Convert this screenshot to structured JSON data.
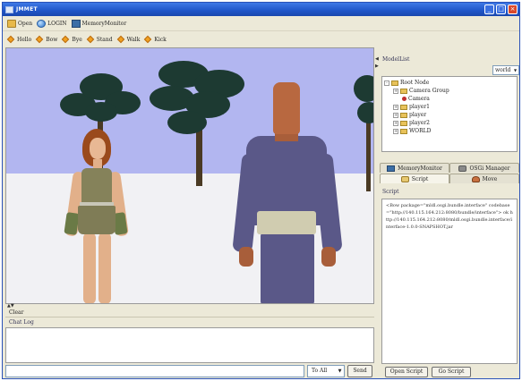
{
  "window": {
    "title": "JMMET",
    "controls": {
      "minimize": "_",
      "maximize": "□",
      "close": "×"
    }
  },
  "toolbar_main": {
    "items": [
      {
        "label": "Open",
        "icon": "folder-icon"
      },
      {
        "label": "LOGIN",
        "icon": "globe-icon"
      },
      {
        "label": "MemoryMonitor",
        "icon": "monitor-icon"
      }
    ]
  },
  "toolbar_actions": {
    "items": [
      "Hello",
      "Bow",
      "Bye",
      "Stand",
      "Walk",
      "Kick"
    ]
  },
  "chat": {
    "clear_label": "Clear",
    "log_label": "Chat Log",
    "input_value": "",
    "target_value": "To All",
    "send_label": "Send"
  },
  "model_list": {
    "label": "ModelList",
    "world_value": "world",
    "tree": [
      {
        "label": "Root Node",
        "level": 0,
        "expander": "-",
        "kind": "folder"
      },
      {
        "label": "Camera Group",
        "level": 1,
        "expander": "+",
        "kind": "folder"
      },
      {
        "label": "Camera",
        "level": 1,
        "expander": "",
        "kind": "leaf"
      },
      {
        "label": "player1",
        "level": 1,
        "expander": "+",
        "kind": "folder"
      },
      {
        "label": "player",
        "level": 1,
        "expander": "+",
        "kind": "folder"
      },
      {
        "label": "player2",
        "level": 1,
        "expander": "+",
        "kind": "folder"
      },
      {
        "label": "WORLD",
        "level": 1,
        "expander": "+",
        "kind": "folder"
      }
    ]
  },
  "tabs_top": [
    {
      "label": "MemoryMonitor",
      "icon": "monitor-icon"
    },
    {
      "label": "OSGi Manager",
      "icon": "gear-icon"
    }
  ],
  "tabs_bottom": [
    {
      "label": "Script",
      "icon": "scroll-icon"
    },
    {
      "label": "Move",
      "icon": "person-icon"
    }
  ],
  "script": {
    "label": "Script",
    "content": "<Bow package=\"mldl.osgi.bundle.interface\" codebase=\"http://140.115.164.212:8080/bundle/interface\"> ok http://140.115.164.212:8080/mldl.osgi.bundle.interface/interface-1.0.0-SNAPSHOT.jar"
  },
  "script_buttons": {
    "open": "Open Script",
    "go": "Go Script"
  },
  "colors": {
    "titlebar": "#1f55c8",
    "sky": "#b2b6f0",
    "ground": "#f1f1f4",
    "panel_bg": "#ece9d8"
  }
}
